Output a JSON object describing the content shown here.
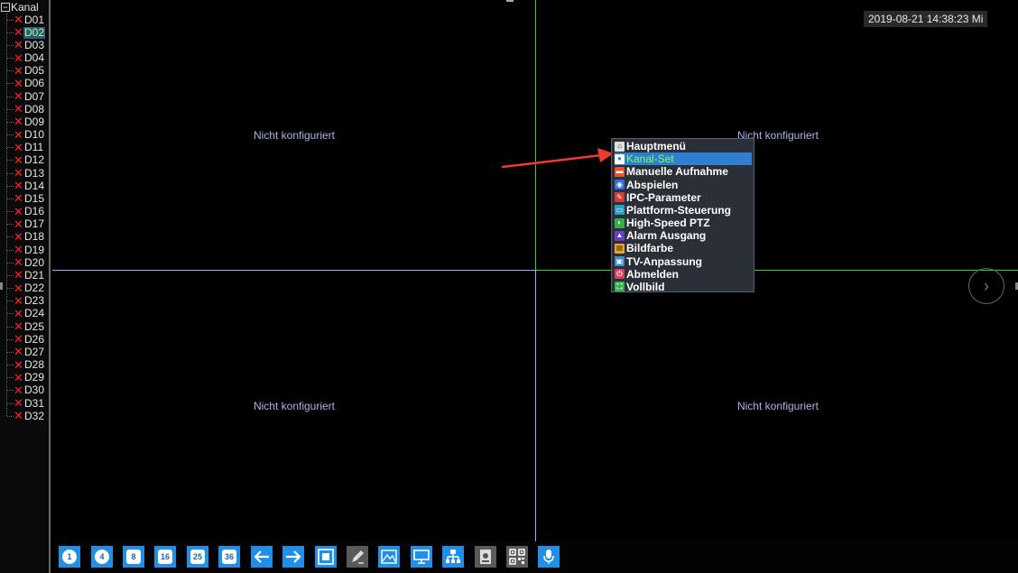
{
  "sidebar": {
    "root_label": "Kanal",
    "channels": [
      "D01",
      "D02",
      "D03",
      "D04",
      "D05",
      "D06",
      "D07",
      "D08",
      "D09",
      "D10",
      "D11",
      "D12",
      "D13",
      "D14",
      "D15",
      "D16",
      "D17",
      "D18",
      "D19",
      "D20",
      "D21",
      "D22",
      "D23",
      "D24",
      "D25",
      "D26",
      "D27",
      "D28",
      "D29",
      "D30",
      "D31",
      "D32"
    ],
    "selected_channel": "D02"
  },
  "grid": {
    "cells": [
      {
        "message": "Nicht konfiguriert"
      },
      {
        "message": "Nicht konfiguriert"
      },
      {
        "message": "Nicht konfiguriert"
      },
      {
        "message": "Nicht konfiguriert"
      }
    ]
  },
  "datetime": "2019-08-21 14:38:23 Mi",
  "context_menu": {
    "items": [
      {
        "label": "Hauptmenü",
        "icon": "home-icon"
      },
      {
        "label": "Kanal-Set",
        "icon": "camera-icon",
        "active": true
      },
      {
        "label": "Manuelle Aufnahme",
        "icon": "record-icon"
      },
      {
        "label": "Abspielen",
        "icon": "playback-icon"
      },
      {
        "label": "IPC-Parameter",
        "icon": "ipc-settings-icon"
      },
      {
        "label": "Plattform-Steuerung",
        "icon": "platform-control-icon"
      },
      {
        "label": "High-Speed PTZ",
        "icon": "ptz-icon"
      },
      {
        "label": "Alarm Ausgang",
        "icon": "alarm-icon"
      },
      {
        "label": "Bildfarbe",
        "icon": "color-grid-icon"
      },
      {
        "label": "TV-Anpassung",
        "icon": "tv-icon"
      },
      {
        "label": "Abmelden",
        "icon": "power-icon"
      },
      {
        "label": "Vollbild",
        "icon": "fullscreen-icon"
      }
    ]
  },
  "toolbar": {
    "layouts": [
      "1",
      "4",
      "8",
      "16",
      "25",
      "36"
    ],
    "buttons": [
      "previous-arrow-icon",
      "next-arrow-icon",
      "single-view-icon",
      "edit-icon",
      "image-icon",
      "monitor-icon",
      "network-icon",
      "disk-icon",
      "qr-code-icon",
      "microphone-icon"
    ]
  },
  "colors": {
    "accent_blue": "#1f8fe8",
    "selection_blue": "#2f7fd0",
    "active_text_green": "#7dff56",
    "error_red": "#ff2020",
    "grid_green": "#2fd02f",
    "grid_purple": "#a9a2ff"
  }
}
